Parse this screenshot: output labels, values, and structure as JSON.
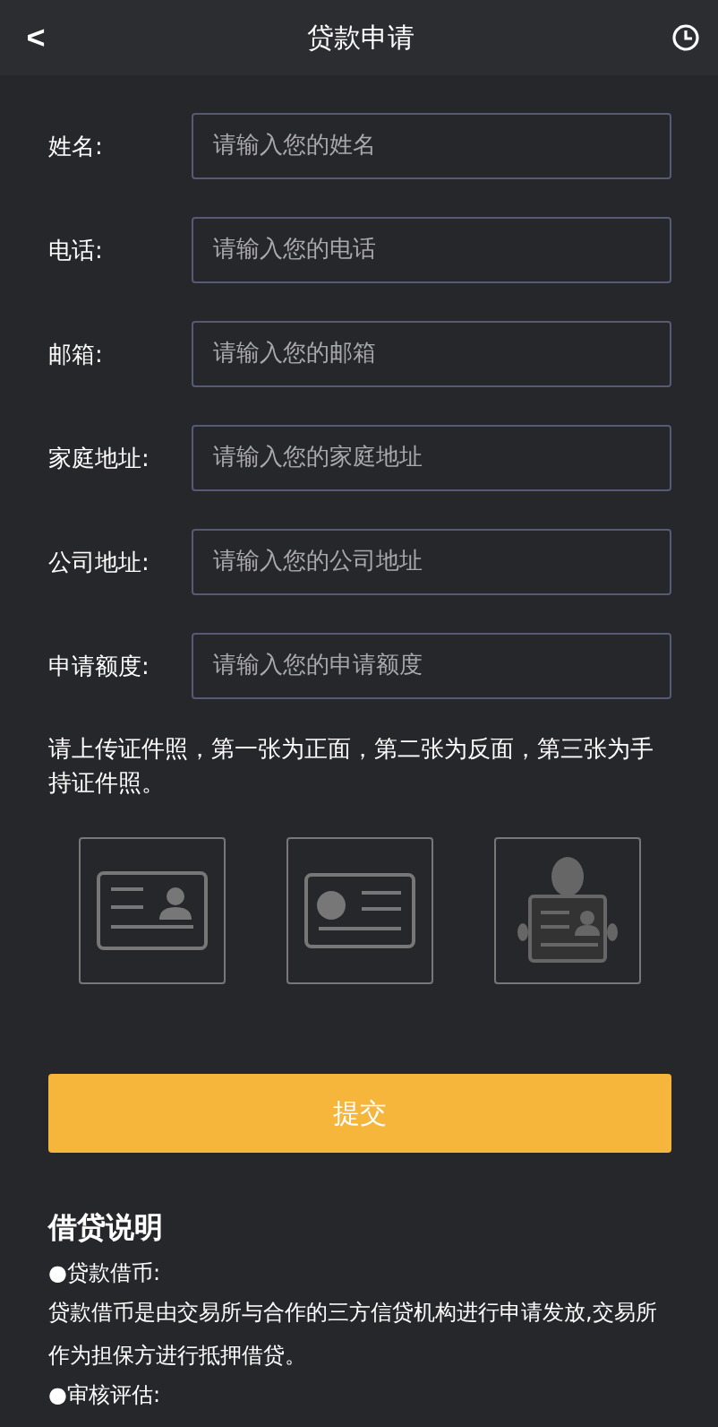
{
  "header": {
    "back": "<",
    "title": "贷款申请"
  },
  "fields": [
    {
      "label": "姓名:",
      "placeholder": "请输入您的姓名"
    },
    {
      "label": "电话:",
      "placeholder": "请输入您的电话"
    },
    {
      "label": "邮箱:",
      "placeholder": "请输入您的邮箱"
    },
    {
      "label": "家庭地址:",
      "placeholder": "请输入您的家庭地址"
    },
    {
      "label": "公司地址:",
      "placeholder": "请输入您的公司地址"
    },
    {
      "label": "申请额度:",
      "placeholder": "请输入您的申请额度"
    }
  ],
  "upload_hint": "请上传证件照，第一张为正面，第二张为反面，第三张为手持证件照。",
  "uploads": [
    {
      "kind": "front"
    },
    {
      "kind": "back"
    },
    {
      "kind": "handheld"
    }
  ],
  "submit": "提交",
  "notes": {
    "title": "借贷说明",
    "lines": [
      {
        "kind": "bullet",
        "text": "●贷款借币:"
      },
      {
        "kind": "para",
        "text": "贷款借币是由交易所与合作的三方信贷机构进行申请发放,交易所作为担保方进行抵押借贷。"
      },
      {
        "kind": "bullet",
        "text": "●审核评估:"
      }
    ]
  }
}
